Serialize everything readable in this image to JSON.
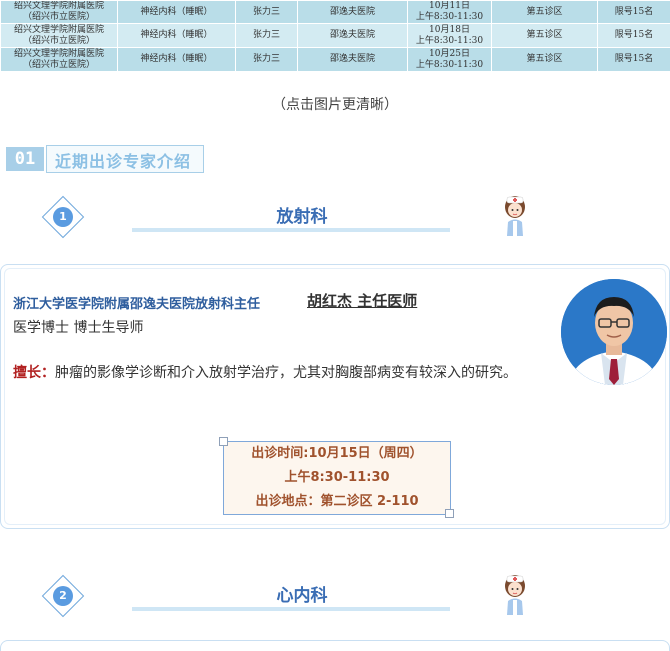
{
  "schedule": {
    "rows": [
      {
        "hospital_line1": "绍兴文理学院附属医院",
        "hospital_line2": "（绍兴市立医院）",
        "department": "神经内科（睡眠）",
        "doctor": "张力三",
        "origin": "邵逸夫医院",
        "date": "10月11日",
        "time": "上午8:30-11:30",
        "room": "第五诊区",
        "quota": "限号15名"
      },
      {
        "hospital_line1": "绍兴文理学院附属医院",
        "hospital_line2": "（绍兴市立医院）",
        "department": "神经内科（睡眠）",
        "doctor": "张力三",
        "origin": "邵逸夫医院",
        "date": "10月18日",
        "time": "上午8:30-11:30",
        "room": "第五诊区",
        "quota": "限号15名"
      },
      {
        "hospital_line1": "绍兴文理学院附属医院",
        "hospital_line2": "（绍兴市立医院）",
        "department": "神经内科（睡眠）",
        "doctor": "张力三",
        "origin": "邵逸夫医院",
        "date": "10月25日",
        "time": "上午8:30-11:30",
        "room": "第五诊区",
        "quota": "限号15名"
      }
    ]
  },
  "tap_hint": "（点击图片更清晰）",
  "section": {
    "number": "01",
    "title": "近期出诊专家介绍"
  },
  "depts": [
    {
      "number": "1",
      "name": "放射科"
    },
    {
      "number": "2",
      "name": "心内科"
    }
  ],
  "doctor": {
    "hospital": "浙江大学医学院附属邵逸夫医院放射科主任",
    "name": "胡红杰 主任医师",
    "degree": "医学博士  博士生导师",
    "specialty_label": "擅长：",
    "specialty_text": "肿瘤的影像学诊断和介入放射学治疗，尤其对胸腹部病变有较深入的研究。",
    "visit_time": "出诊时间:10月15日（周四）",
    "visit_hours": "上午8:30-11:30",
    "visit_place": "出诊地点：第二诊区 2-110"
  },
  "colors": {
    "accent": "#3a6db4",
    "banner": "#a8cfe8",
    "specialty_label": "#b22222",
    "visit_text": "#a0522d"
  }
}
